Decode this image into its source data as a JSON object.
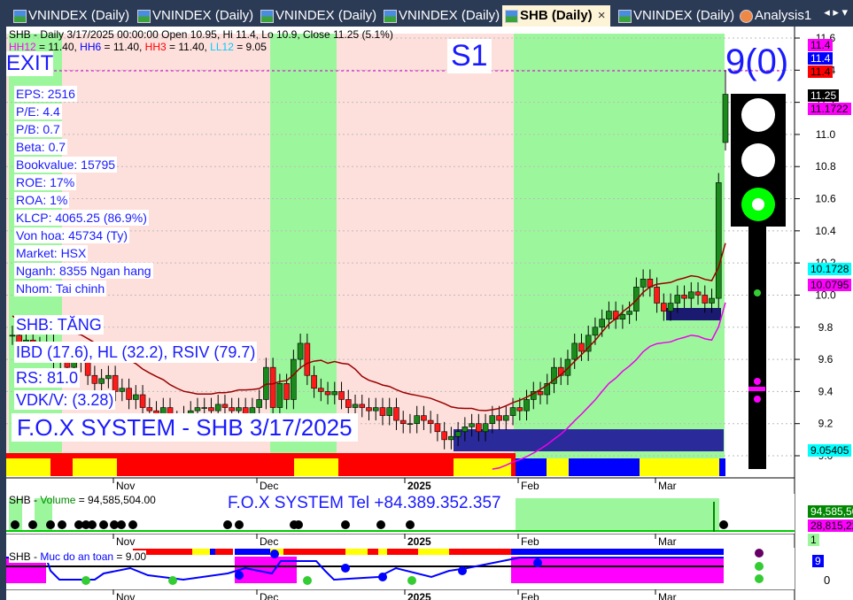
{
  "tabs": [
    {
      "label": "VNINDEX (Daily)"
    },
    {
      "label": "VNINDEX (Daily)"
    },
    {
      "label": "VNINDEX (Daily)"
    },
    {
      "label": "VNINDEX (Daily)"
    },
    {
      "label": "SHB (Daily)",
      "active": true
    },
    {
      "label": "VNINDEX (Daily)"
    },
    {
      "label": "Analysis1"
    }
  ],
  "tab_close": "×",
  "tab_nav": "◂ ▸ ▾",
  "header": {
    "title": "SHB - Daily 3/17/2025 00:00:00 Open 10.95, Hi 11.4, Lo 10.9, Close 11.25 (5.1%)",
    "hh12": "HH12",
    "hh12_v": " = 11.40, ",
    "hh6": "HH6",
    "hh6_v": " = 11.40, ",
    "hh3": "HH3",
    "hh3_v": " = 11.40, ",
    "ll12": "LL12",
    "ll12_v": " = 9.05"
  },
  "signal": "EXIT",
  "stage": "S1",
  "score": "9(0)",
  "fundamentals": [
    "EPS: 2516",
    "P/E: 4.4",
    "P/B: 0.7",
    "Beta: 0.7",
    "Bookvalue: 15795",
    "ROE: 17%",
    "ROA: 1%",
    "KLCP: 4065.25 (86.9%)",
    "Von hoa: 45734 (Ty)",
    "Market: HSX",
    "Nganh: 8355 Ngan hang",
    "Nhom: Tai chinh"
  ],
  "trend": "SHB: TĂNG",
  "ratings": "IBD (17.6), HL (32.2), RSIV (79.7)",
  "rs": "RS: 81.0",
  "vdk": "VDK/V:  (3.28)",
  "watermark": "F.O.X SYSTEM - SHB 3/17/2025",
  "price_labels": [
    {
      "v": "11.4",
      "bg": "#ff00ff",
      "fg": "#000"
    },
    {
      "v": "11.4",
      "bg": "#0000ff",
      "fg": "#fff"
    },
    {
      "v": "11.4",
      "bg": "#ff0000",
      "fg": "#000"
    },
    {
      "v": "11.25",
      "bg": "#000",
      "fg": "#fff"
    },
    {
      "v": "11.1722",
      "bg": "#ff00ff",
      "fg": "#000"
    },
    {
      "v": "10.1728",
      "bg": "#00ffff",
      "fg": "#000"
    },
    {
      "v": "10.0795",
      "bg": "#ff00ff",
      "fg": "#000"
    },
    {
      "v": "9.05405",
      "bg": "#00ffff",
      "fg": "#000"
    }
  ],
  "volume": {
    "title": "SHB - ",
    "name": "Volume",
    "value": " = 94,585,504.00",
    "contact": "F.O.X SYSTEM Tel +84.389.352.357",
    "labels": [
      "94,585,50",
      "28,815,22",
      "1"
    ]
  },
  "safety": {
    "title": "SHB - ",
    "name": "Muc do an toan",
    "value": " = 9.00",
    "label": "9",
    "zero": "0"
  },
  "chart_data": {
    "type": "candlestick",
    "symbol": "SHB",
    "interval": "Daily",
    "yticks": [
      "11.6",
      "11.4",
      "11.2",
      "11.0",
      "10.8",
      "10.6",
      "10.4",
      "10.2",
      "10.0",
      "9.8",
      "9.6",
      "9.4",
      "9.2",
      "9.0"
    ],
    "ylim": [
      9.0,
      11.6
    ],
    "xticks": [
      "Nov",
      "Dec",
      "2025",
      "Feb",
      "Mar"
    ],
    "closes": [
      9.75,
      9.7,
      9.72,
      9.68,
      9.65,
      9.7,
      9.6,
      9.62,
      9.55,
      9.58,
      9.6,
      9.5,
      9.45,
      9.48,
      9.5,
      9.4,
      9.42,
      9.35,
      9.38,
      9.3,
      9.28,
      9.25,
      9.3,
      9.22,
      9.2,
      9.25,
      9.28,
      9.3,
      9.3,
      9.28,
      9.32,
      9.3,
      9.28,
      9.3,
      9.25,
      9.3,
      9.35,
      9.55,
      9.3,
      9.45,
      9.35,
      9.6,
      9.7,
      9.5,
      9.42,
      9.4,
      9.38,
      9.4,
      9.35,
      9.3,
      9.32,
      9.3,
      9.28,
      9.3,
      9.25,
      9.3,
      9.22,
      9.2,
      9.2,
      9.25,
      9.22,
      9.2,
      9.15,
      9.1,
      9.12,
      9.15,
      9.18,
      9.2,
      9.15,
      9.2,
      9.25,
      9.22,
      9.25,
      9.3,
      9.28,
      9.35,
      9.4,
      9.38,
      9.45,
      9.55,
      9.5,
      9.6,
      9.7,
      9.65,
      9.75,
      9.8,
      9.85,
      9.9,
      9.85,
      9.88,
      9.9,
      10.05,
      10.1,
      10.05,
      9.95,
      9.9,
      9.95,
      10.0,
      9.98,
      10.02,
      10.0,
      9.95,
      9.98,
      10.7,
      11.25
    ],
    "last": {
      "open": 10.95,
      "high": 11.4,
      "low": 10.9,
      "close": 11.25
    }
  },
  "colors": {
    "up": "#1a8a1a",
    "down": "#ff1a1a",
    "green_zone": "#9cf79c",
    "pink_zone": "#fde0dc",
    "blue_text": "#1a1aff"
  }
}
